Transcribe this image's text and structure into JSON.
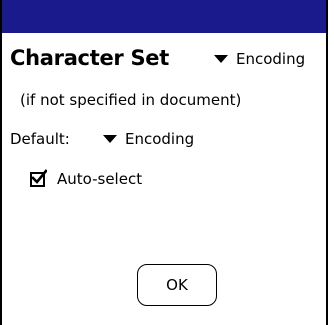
{
  "dialog": {
    "heading": "Character Set",
    "header_dropdown": {
      "selected": "Encoding",
      "icon": "triangle-down-icon"
    },
    "note": "(if not specified in document)",
    "default": {
      "label": "Default:",
      "selected": "Encoding",
      "icon": "triangle-down-icon"
    },
    "auto_select": {
      "label": "Auto-select",
      "checked": true
    },
    "ok_label": "OK"
  },
  "colors": {
    "title_bar": "#1a1a8c",
    "border": "#000000",
    "background": "#ffffff"
  }
}
